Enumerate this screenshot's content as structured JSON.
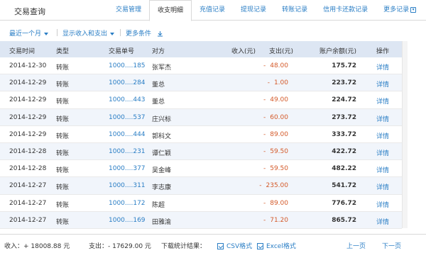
{
  "header": {
    "title": "交易查询",
    "tabs": [
      {
        "label": "交易管理"
      },
      {
        "label": "收支明细"
      },
      {
        "label": "充值记录"
      },
      {
        "label": "提现记录"
      },
      {
        "label": "转账记录"
      },
      {
        "label": "信用卡还款记录"
      },
      {
        "label": "更多记录"
      }
    ],
    "active_tab": "收支明细"
  },
  "filters": {
    "period": "最近一个月",
    "mode": "显示收入和支出",
    "more": "更多条件"
  },
  "table": {
    "columns": [
      "交易时间",
      "类型",
      "交易单号",
      "对方",
      "收入(元)",
      "支出(元)",
      "账户余额(元)",
      "操作"
    ],
    "rows": [
      {
        "time": "2014-12-30",
        "type": "转账",
        "number": "1000....185",
        "party": "张军杰",
        "income": "",
        "expense": "48.00",
        "balance": "175.72",
        "action": "详情"
      },
      {
        "time": "2014-12-29",
        "type": "转账",
        "number": "1000....284",
        "party": "董总",
        "income": "",
        "expense": "1.00",
        "balance": "223.72",
        "action": "详情"
      },
      {
        "time": "2014-12-29",
        "type": "转账",
        "number": "1000....443",
        "party": "董总",
        "income": "",
        "expense": "49.00",
        "balance": "224.72",
        "action": "详情"
      },
      {
        "time": "2014-12-29",
        "type": "转账",
        "number": "1000....537",
        "party": "庄兴标",
        "income": "",
        "expense": "60.00",
        "balance": "273.72",
        "action": "详情"
      },
      {
        "time": "2014-12-29",
        "type": "转账",
        "number": "1000....444",
        "party": "郭科文",
        "income": "",
        "expense": "89.00",
        "balance": "333.72",
        "action": "详情"
      },
      {
        "time": "2014-12-28",
        "type": "转账",
        "number": "1000....231",
        "party": "谭仁颖",
        "income": "",
        "expense": "59.50",
        "balance": "422.72",
        "action": "详情"
      },
      {
        "time": "2014-12-28",
        "type": "转账",
        "number": "1000....377",
        "party": "吴金峰",
        "income": "",
        "expense": "59.50",
        "balance": "482.22",
        "action": "详情"
      },
      {
        "time": "2014-12-27",
        "type": "转账",
        "number": "1000....311",
        "party": "李志康",
        "income": "",
        "expense": "235.00",
        "balance": "541.72",
        "action": "详情"
      },
      {
        "time": "2014-12-27",
        "type": "转账",
        "number": "1000....172",
        "party": "陈超",
        "income": "",
        "expense": "89.00",
        "balance": "776.72",
        "action": "详情"
      },
      {
        "time": "2014-12-27",
        "type": "转账",
        "number": "1000....169",
        "party": "田雅渝",
        "income": "",
        "expense": "71.20",
        "balance": "865.72",
        "action": "详情"
      }
    ]
  },
  "footer": {
    "income_summary": "收入：+ 18008.88 元",
    "expense_summary": "支出：- 17629.00 元",
    "download_label": "下载统计结果：",
    "csv": "CSV格式",
    "excel": "Excel格式",
    "prev": "上一页",
    "next": "下一页"
  },
  "colors": {
    "link": "#2a7ec5",
    "expense": "#d45a2a",
    "header_bg": "#dde6f3",
    "alt_row": "#f1f5fb"
  },
  "icons": [
    "chevron-down-icon",
    "download-icon",
    "csv-icon",
    "excel-icon"
  ]
}
